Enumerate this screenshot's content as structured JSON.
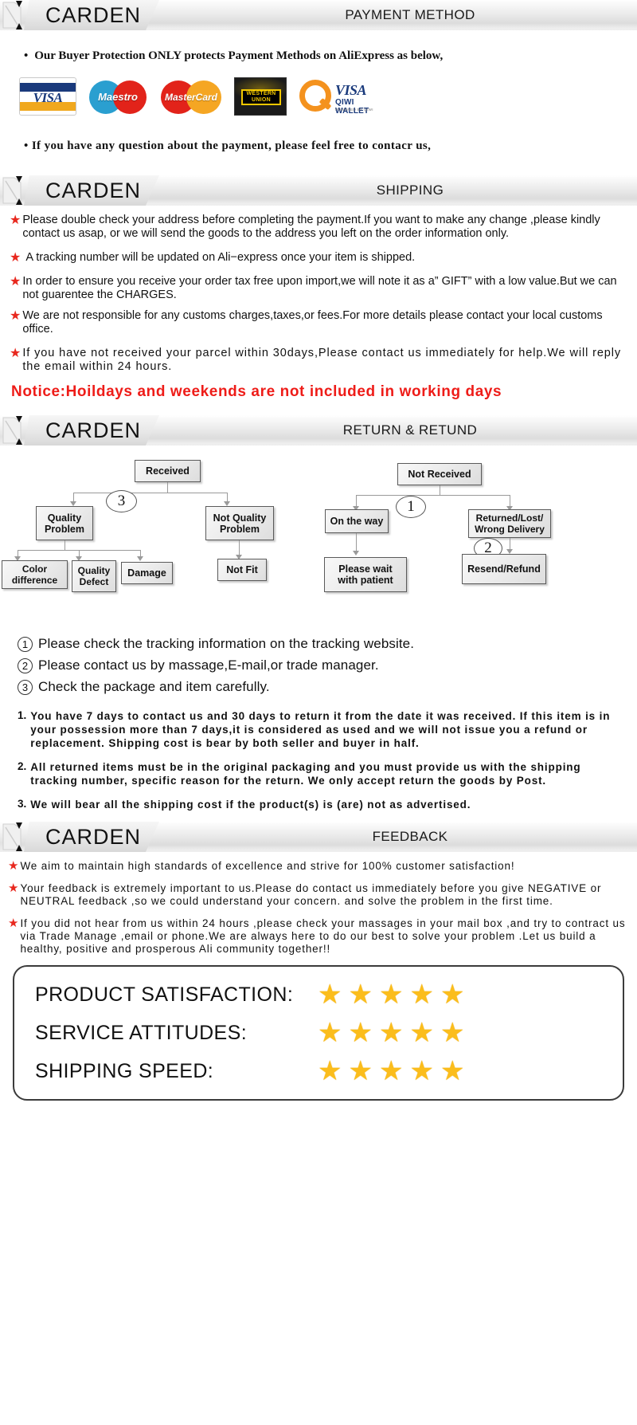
{
  "brand": "CARDEN",
  "sections": {
    "payment": {
      "title": "PAYMENT METHOD",
      "line1": "Our Buyer Protection ONLY protects Payment Methods on AliExpress as below,",
      "line2": "If you have any question about the payment, please feel free to contacr us,",
      "bullet": "•",
      "logos": [
        {
          "name": "visa-logo",
          "label": "VISA"
        },
        {
          "name": "maestro-logo",
          "label": "Maestro"
        },
        {
          "name": "mastercard-logo",
          "label": "MasterCard"
        },
        {
          "name": "western-union-logo",
          "line1": "WESTERN",
          "line2": "UNION"
        },
        {
          "name": "qiwi-wallet-logo",
          "visa": "VISA",
          "wallet": "QIWI WALLET",
          "powered": "POWERED BY QIWI"
        }
      ]
    },
    "shipping": {
      "title": "SHIPPING",
      "star": "★",
      "items": [
        "Please double check your address before completing the payment.If you want to make any change ,please kindly contact us asap, or we will send the goods to the address you left on the order information only.",
        "A tracking number will be updated on Ali−express once your item is shipped.",
        "In order to ensure you receive your order tax free upon import,we will note it as a” GIFT” with a low value.But we can not guarentee the CHARGES.",
        "We are not responsible for any customs charges,taxes,or fees.For more details please contact your local customs office.",
        "If you have not received your parcel within 30days,Please contact us immediately for help.We will reply the email within 24 hours."
      ],
      "notice": "Notice:Hoildays and weekends  are  not  included  in  working  days"
    },
    "return": {
      "title": "RETURN & RETUND",
      "flow": {
        "received": "Received",
        "quality_problem": "Quality\nProblem",
        "not_quality_problem": "Not Quality\nProblem",
        "color_difference": "Color\ndifference",
        "quality_defect": "Quality\nDefect",
        "damage": "Damage",
        "not_fit": "Not Fit",
        "not_received": "Not  Received",
        "on_the_way": "On the way",
        "returned_lost": "Returned/Lost/\nWrong Delivery",
        "please_wait": "Please wait\nwith patient",
        "resend_refund": "Resend/Refund",
        "badge1": "1",
        "badge2": "2",
        "badge3": "3"
      },
      "notes": [
        {
          "num": "①",
          "n": "1",
          "text": "Please check the tracking information on the tracking website."
        },
        {
          "num": "②",
          "n": "2",
          "text": "Please contact us by  massage,E-mail,or trade manager."
        },
        {
          "num": "③",
          "n": "3",
          "text": "Check the package and item carefully."
        }
      ],
      "ordered": [
        {
          "n": "1.",
          "text": "You have 7 days to contact us and 30 days to return it from the date it was received. If this item is in your possession more than 7 days,it is considered as used and we will not issue you a refund or replacement. Shipping cost is bear by both seller and buyer in half."
        },
        {
          "n": "2.",
          "text": "All returned items must be in the original packaging and you must provide us with the shipping tracking number, specific reason for the return. We only accept return the goods by Post."
        },
        {
          "n": "3.",
          "text": "We will bear all the shipping cost if the product(s) is (are) not as advertised."
        }
      ]
    },
    "feedback": {
      "title": "FEEDBACK",
      "star": "★",
      "items": [
        "We aim to maintain high standards of excellence and strive  for 100% customer satisfaction!",
        "Your feedback is extremely important to us.Please do contact us immediately before you give NEGATIVE or NEUTRAL feedback ,so  we could understand your concern. and solve the problem in the first time.",
        "If you did not hear from us within 24 hours ,please check your massages in your mail box ,and try to contract us via Trade Manage ,email or phone.We are always here to do our best to solve your problem .Let us build a healthy, positive and prosperous Ali community together!!"
      ],
      "ratings": [
        {
          "label": "PRODUCT SATISFACTION:",
          "stars": 5
        },
        {
          "label": "SERVICE  ATTITUDES:",
          "stars": 5
        },
        {
          "label": "SHIPPING SPEED:",
          "stars": 5
        }
      ],
      "star_glyph": "★"
    }
  },
  "colors": {
    "red_star": "#e8281e",
    "notice_red": "#ee1c18",
    "star_gold": "#fbbd1c",
    "visa_blue": "#1a3a7c",
    "visa_gold": "#f0a81e",
    "maestro_blue": "#2a9fd0",
    "mc_red": "#e2231a",
    "mc_orange": "#f5a623",
    "qiwi_orange": "#f4921e"
  }
}
